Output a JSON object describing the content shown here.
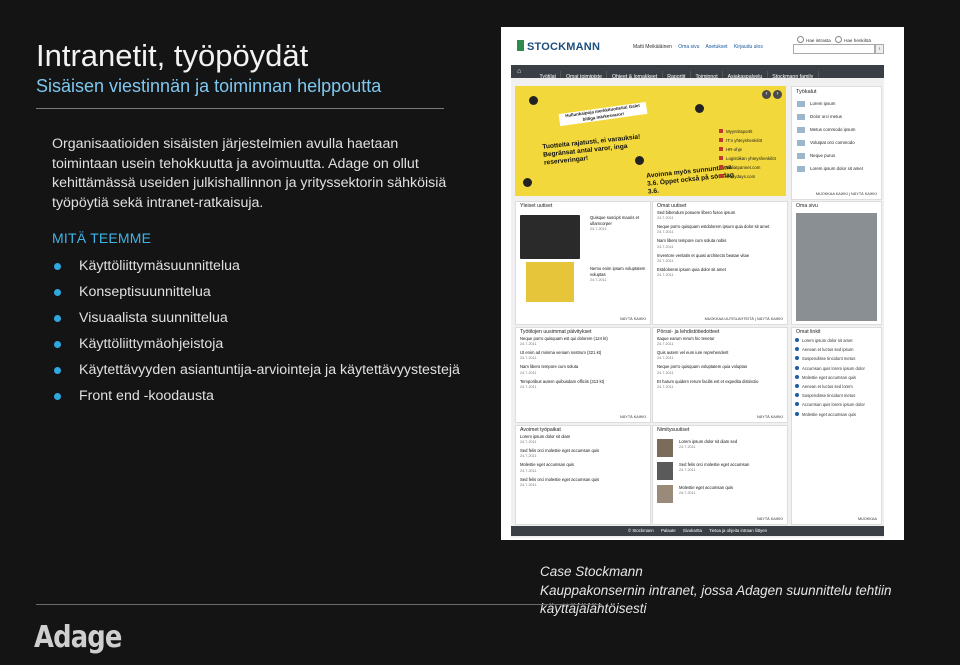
{
  "slide": {
    "title": "Intranetit, työpöydät",
    "subtitle": "Sisäisen viestinnän ja toiminnan helppoutta",
    "intro": "Organisaatioiden sisäisten järjestelmien avulla haetaan toimintaan usein tehokkuutta ja avoimuutta. Adage on ollut kehittämässä useiden julkishallinnon ja yrityssektorin sähköisiä työpöytiä sekä intranet-ratkaisuja.",
    "section_heading": "MITÄ TEEMME",
    "services": [
      "Käyttöliittymäsuunnittelua",
      "Konseptisuunnittelua",
      "Visuaalista suunnittelua",
      "Käyttöliittymäohjeistoja",
      "Käytettävyyden asiantuntija-arviointeja ja käytettävyystestejä",
      "Front end -koodausta"
    ],
    "logo": "Adage",
    "caption": {
      "line1": "Case Stockmann",
      "line2": "Kauppakonsernin intranet, jossa Adagen suunnittelu tehtiin",
      "line3": "käyttäjälähtöisesti"
    }
  },
  "screenshot": {
    "brand": "STOCKMANN",
    "user_links": [
      "Matti Meikäläinen",
      "Oma sivu",
      "Asetukset",
      "Kirjaudu ulos"
    ],
    "search_options": [
      "Hae intrasta",
      "Hae henkilöä"
    ],
    "nav": [
      "Työtilat",
      "Omat toimipiste",
      "Ohjeet & lomakkeet",
      "Raportit",
      "Toiminnot",
      "Asiakaspalvelu",
      "Stockmann family"
    ],
    "banner": {
      "headline": "Hullunkaipoja merkkituotteita! Galet billiga märkesvaror!",
      "line2": "Tuotteita rajatusti, ei varauksia! Begränsat antal varor, inga reserveringar!",
      "line3": "Avoinna myös sunnuntaina 3.6. Öppet också på söndag 3.6."
    },
    "quick_links": [
      "Myyntiraportit",
      "IT:n yhteyshenkilöt",
      "HR-ohje",
      "Logistiikan yhteyshenkilöt",
      "Isoliatpannet.com",
      "crazydays.com"
    ],
    "tools": {
      "title": "Työkalut",
      "items": [
        "Lorem ipsum",
        "Dolor orci metus",
        "Metus commodo ipsum",
        "Volutpat orci commodo",
        "Neque purus",
        "Lorem ipsum dolor sit amet"
      ],
      "more": "MUOKKAA KAIKKI | NÄYTÄ KAIKKI"
    },
    "general_news": {
      "title": "Yleiset uutiset",
      "items": [
        {
          "text": "Quisque suscipit mauris et ullamcorper",
          "date": "24.7.2011"
        },
        {
          "text": "Nemo enim ipsam voluptatem voluptas",
          "date": "24.7.2011"
        }
      ],
      "more": "NÄYTÄ KAIKKI"
    },
    "own_news": {
      "title": "Omat uutiset",
      "items": [
        {
          "text": "Sed bibendum posuere libero fusce ipsum",
          "date": "24.7.2011"
        },
        {
          "text": "Neque porro quisquam estdolorem ipsum quia dolor sit amet",
          "date": "24.7.2011"
        },
        {
          "text": "Nam libero tempore cum soluta nobis",
          "date": "24.7.2011"
        },
        {
          "text": "Inventore veritatis et quasi architecto beatae vitae",
          "date": "24.7.2011"
        },
        {
          "text": "Estdolorem ipsum quia dolor sit amet",
          "date": "24.7.2011"
        }
      ],
      "more": "MUOKKAA UUTISLÄHTEITÄ | NÄYTÄ KAIKKI"
    },
    "own_page": {
      "title": "Oma sivu"
    },
    "workspace_updates": {
      "title": "Työtilojen uusimmat päivitykset",
      "items": [
        {
          "text": "Neque porro quisquam est qui dolorem (124 kt)",
          "date": "24.7.2011"
        },
        {
          "text": "Ut enim ad minima veniam nostrum (321 kt)",
          "date": "24.7.2011"
        },
        {
          "text": "Nam libero tempore cum soluta",
          "date": "24.7.2011"
        },
        {
          "text": "Temporibus autem quibusdam officiis (313 kt)",
          "date": "24.7.2011"
        }
      ],
      "more": "NÄYTÄ KAIKKI"
    },
    "stock_news": {
      "title": "Pörssi- ja lehdistötiedotteet",
      "items": [
        {
          "text": "Itaque earum rerum hic tenetur",
          "date": "24.7.2011"
        },
        {
          "text": "Quis autem vel eum iure reprehenderit",
          "date": "24.7.2011"
        },
        {
          "text": "Neque porro quisquam voluptatem quia voluptas",
          "date": "24.7.2011"
        },
        {
          "text": "Et harum quidem rerum facilis est et expedita distinctio",
          "date": "24.7.2011"
        }
      ],
      "more": "NÄYTÄ KAIKKI"
    },
    "own_links": {
      "title": "Omat linkit",
      "items": [
        "Lorem ipsum dolor sit amet",
        "Aenean et luctus sed ipsum",
        "Suspendisse tincidunt metus",
        "Accumsan quis lorem ipsum dolor",
        "Molestie eget accumsan quis",
        "Aenean et luctus sed lorem",
        "Suspendisse tincidunt metus",
        "Accumsan quis lorem ipsum dolor",
        "Molestie eget accumsan quis"
      ],
      "more": "MUOKKAA"
    },
    "open_jobs": {
      "title": "Avoimet työpaikat",
      "items": [
        {
          "text": "Lorem ipsum dolor sit diam",
          "date": "24.7.2011"
        },
        {
          "text": "Sed felis orci molestie eget accumsan quis",
          "date": "24.7.2011"
        },
        {
          "text": "Molestie eget accumsan quis",
          "date": "24.7.2011"
        },
        {
          "text": "Sed felis orci molestie eget accumsan quis",
          "date": "24.7.2011"
        }
      ]
    },
    "appointments": {
      "title": "Nimitysuutiset",
      "items": [
        {
          "text": "Lorem ipsum dolor sit diam sed",
          "date": "24.7.2011"
        },
        {
          "text": "Sed felis orci molestie eget accumsan",
          "date": "24.7.2011"
        },
        {
          "text": "Molestie eget accumsan quis",
          "date": "24.7.2011"
        }
      ],
      "more": "NÄYTÄ KAIKKI"
    },
    "footer": [
      "© Stockmann",
      "Palaute",
      "Sivukartta",
      "Tietoa ja ohjeita intraan liittyen"
    ]
  }
}
